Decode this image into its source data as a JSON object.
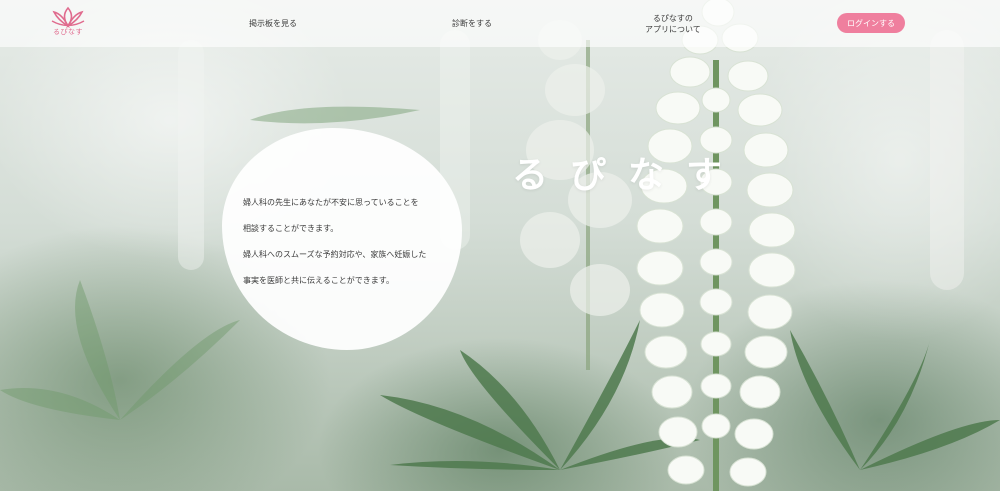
{
  "logo": {
    "text": "るぴなす",
    "color": "#e06b8e"
  },
  "nav": {
    "bbs": "掲示板を見る",
    "diagnosis": "診断をする",
    "about_line1": "るぴなすの",
    "about_line2": "アプリについて"
  },
  "login": {
    "label": "ログインする",
    "color": "#ef7f9e"
  },
  "hero": {
    "title": "るぴなす",
    "lines": [
      "婦人科の先生にあなたが不安に思っていることを",
      "相談することができます。",
      "婦人科へのスムーズな予約対応や、家族へ妊娠した",
      "事実を医師と共に伝えることができます。"
    ]
  }
}
